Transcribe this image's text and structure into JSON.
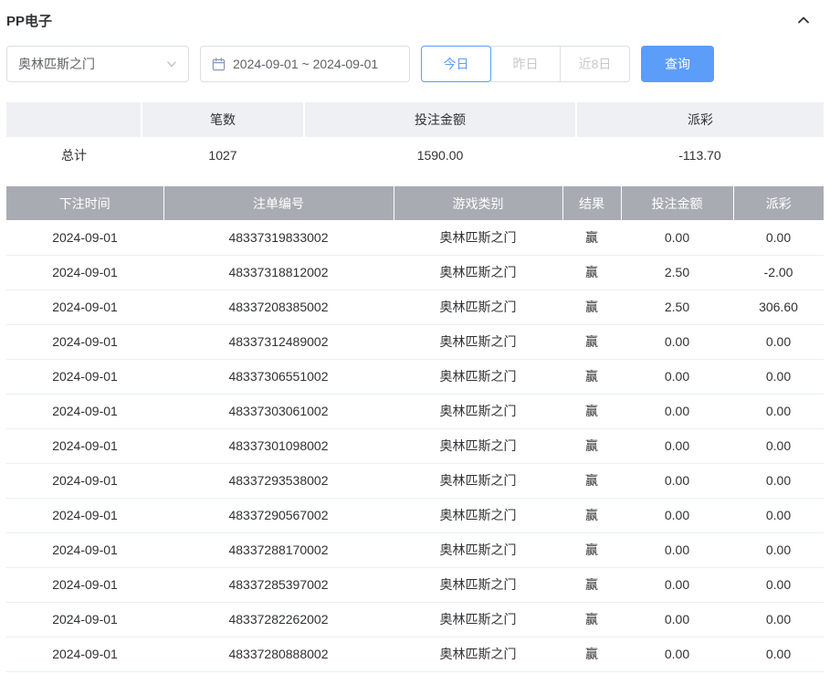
{
  "header": {
    "title": "PP电子"
  },
  "filters": {
    "game_select": {
      "value": "奥林匹斯之门"
    },
    "date_range": {
      "value": "2024-09-01 ~ 2024-09-01"
    },
    "quick_buttons": [
      {
        "label": "今日",
        "active": true
      },
      {
        "label": "昨日",
        "active": false
      },
      {
        "label": "近8日",
        "active": false
      }
    ],
    "search_label": "查询"
  },
  "summary": {
    "headers": [
      "",
      "笔数",
      "投注金额",
      "派彩"
    ],
    "total": {
      "label": "总计",
      "count": "1027",
      "bet_amount": "1590.00",
      "payout": "-113.70"
    }
  },
  "table": {
    "headers": [
      "下注时间",
      "注单编号",
      "游戏类别",
      "结果",
      "投注金额",
      "派彩"
    ],
    "rows": [
      {
        "date": "2024-09-01",
        "bet_id": "48337319833002",
        "game": "奥林匹斯之门",
        "result": "赢",
        "bet_amount": "0.00",
        "payout": "0.00"
      },
      {
        "date": "2024-09-01",
        "bet_id": "48337318812002",
        "game": "奥林匹斯之门",
        "result": "赢",
        "bet_amount": "2.50",
        "payout": "-2.00"
      },
      {
        "date": "2024-09-01",
        "bet_id": "48337208385002",
        "game": "奥林匹斯之门",
        "result": "赢",
        "bet_amount": "2.50",
        "payout": "306.60"
      },
      {
        "date": "2024-09-01",
        "bet_id": "48337312489002",
        "game": "奥林匹斯之门",
        "result": "赢",
        "bet_amount": "0.00",
        "payout": "0.00"
      },
      {
        "date": "2024-09-01",
        "bet_id": "48337306551002",
        "game": "奥林匹斯之门",
        "result": "赢",
        "bet_amount": "0.00",
        "payout": "0.00"
      },
      {
        "date": "2024-09-01",
        "bet_id": "48337303061002",
        "game": "奥林匹斯之门",
        "result": "赢",
        "bet_amount": "0.00",
        "payout": "0.00"
      },
      {
        "date": "2024-09-01",
        "bet_id": "48337301098002",
        "game": "奥林匹斯之门",
        "result": "赢",
        "bet_amount": "0.00",
        "payout": "0.00"
      },
      {
        "date": "2024-09-01",
        "bet_id": "48337293538002",
        "game": "奥林匹斯之门",
        "result": "赢",
        "bet_amount": "0.00",
        "payout": "0.00"
      },
      {
        "date": "2024-09-01",
        "bet_id": "48337290567002",
        "game": "奥林匹斯之门",
        "result": "赢",
        "bet_amount": "0.00",
        "payout": "0.00"
      },
      {
        "date": "2024-09-01",
        "bet_id": "48337288170002",
        "game": "奥林匹斯之门",
        "result": "赢",
        "bet_amount": "0.00",
        "payout": "0.00"
      },
      {
        "date": "2024-09-01",
        "bet_id": "48337285397002",
        "game": "奥林匹斯之门",
        "result": "赢",
        "bet_amount": "0.00",
        "payout": "0.00"
      },
      {
        "date": "2024-09-01",
        "bet_id": "48337282262002",
        "game": "奥林匹斯之门",
        "result": "赢",
        "bet_amount": "0.00",
        "payout": "0.00"
      },
      {
        "date": "2024-09-01",
        "bet_id": "48337280888002",
        "game": "奥林匹斯之门",
        "result": "赢",
        "bet_amount": "0.00",
        "payout": "0.00"
      }
    ]
  },
  "colors": {
    "accent": "#5b9df9",
    "negative": "#f56c6c",
    "table_header_bg": "#a8abb2"
  }
}
